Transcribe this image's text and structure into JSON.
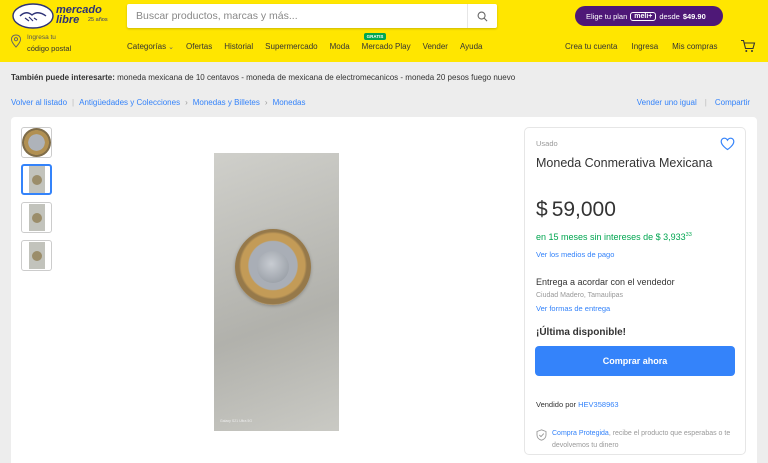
{
  "header": {
    "logo_line1": "mercado",
    "logo_line2": "libre",
    "logo_years": "25 años",
    "search_placeholder": "Buscar productos, marcas y más...",
    "promo_text": "Elige tu plan",
    "promo_chip": "meli+",
    "promo_desde": "desde",
    "promo_price": "$49.90",
    "brand_color": "#ffe600",
    "accent_color": "#3483fa"
  },
  "location": {
    "line1": "Ingresa tu",
    "line2": "código postal"
  },
  "nav": {
    "items": [
      "Categorías",
      "Ofertas",
      "Historial",
      "Supermercado",
      "Moda",
      "Mercado Play",
      "Vender",
      "Ayuda"
    ],
    "gratis_badge": "GRATIS",
    "right": [
      "Crea tu cuenta",
      "Ingresa",
      "Mis compras"
    ]
  },
  "related": {
    "label": "También puede interesarte:",
    "items": "moneda mexicana de 10 centavos - moneda de mexicana de electromecanicos - moneda 20 pesos fuego nuevo"
  },
  "breadcrumb": {
    "back": "Volver al listado",
    "items": [
      "Antigüedades y Colecciones",
      "Monedas y Billetes",
      "Monedas"
    ],
    "sell_similar": "Vender uno igual",
    "share": "Compartir"
  },
  "product": {
    "condition": "Usado",
    "title": "Moneda Conmerativa Mexicana",
    "currency": "$",
    "price": "59,000",
    "installments_prefix": "en",
    "installments_text": "15 meses sin intereses de",
    "installment_amount": "$ 3,933",
    "installment_cents": "33",
    "payment_methods": "Ver los medios de pago",
    "delivery": "Entrega a acordar con el vendedor",
    "city": "Ciudad Madero, Tamaulipas",
    "delivery_link": "Ver formas de entrega",
    "stock": "¡Última disponible!",
    "buy_button": "Comprar ahora",
    "seller_prefix": "Vendido por",
    "seller_name": "HEV358963",
    "protect_link": "Compra Protegida",
    "protect_text": ", recibe el producto que esperabas o te devolvemos tu dinero",
    "photo_watermark": "Galaxy S21 Ultra 5G",
    "success_color": "#00a650"
  }
}
